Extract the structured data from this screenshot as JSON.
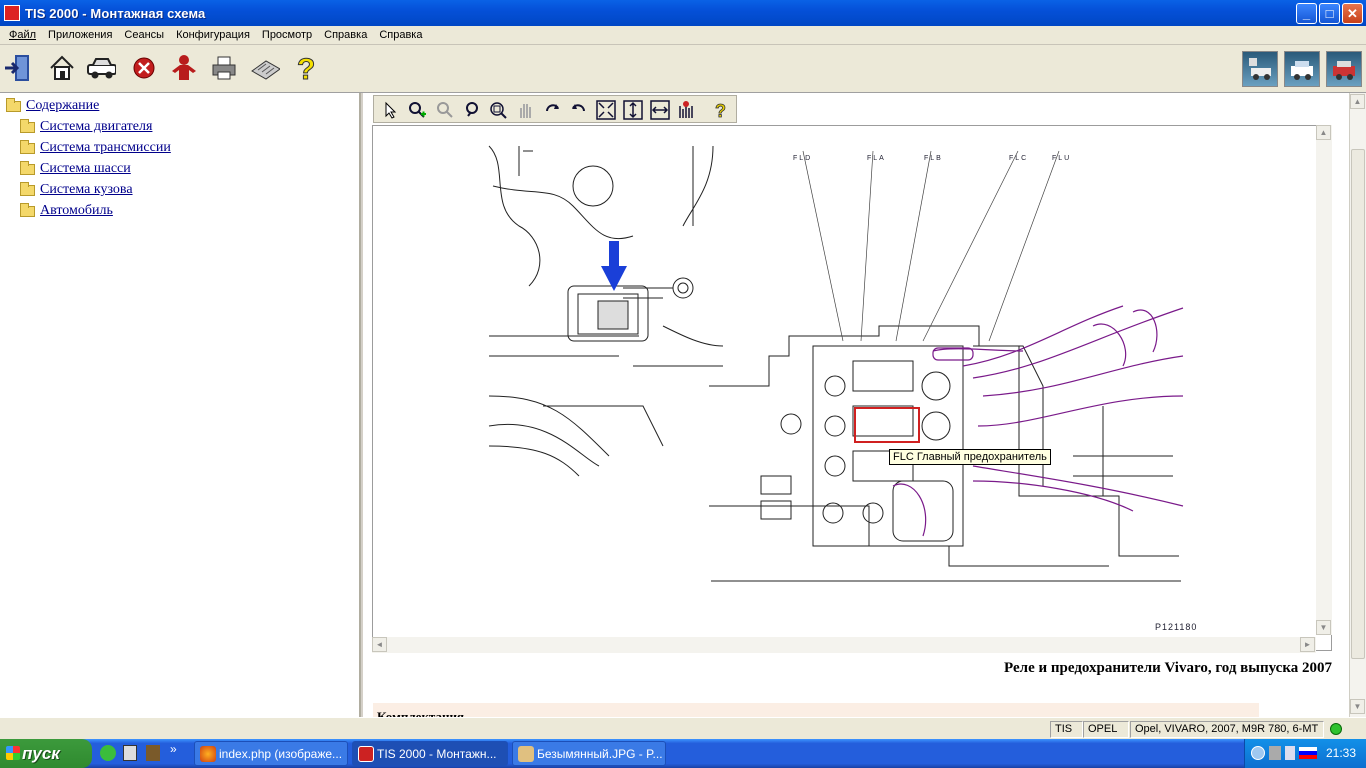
{
  "window": {
    "title": "TIS 2000 - Монтажная схема"
  },
  "menu": {
    "items": [
      "Файл",
      "Приложения",
      "Сеансы",
      "Конфигурация",
      "Просмотр",
      "Справка",
      "Справка"
    ]
  },
  "tree": {
    "root": "Содержание",
    "children": [
      "Система двигателя",
      "Система трансмиссии",
      "Система шасси",
      "Система кузова",
      "Автомобиль"
    ]
  },
  "diagram": {
    "fuse_labels": [
      "FLD",
      "FLA",
      "FLB",
      "FLC",
      "FLU"
    ],
    "tooltip": "FLC Главный предохранитель",
    "picture_number": "P121180",
    "caption": "Реле и предохранители Vivaro, год выпуска 2007"
  },
  "bottom_panel": {
    "text": "Комплектация"
  },
  "statusbar": {
    "fields": [
      "TIS",
      "OPEL",
      "Opel, VIVARO, 2007, M9R 780, 6-MT"
    ]
  },
  "taskbar": {
    "start": "пуск",
    "tasks": [
      "index.php (изображе...",
      "TIS 2000 - Монтажн...",
      "Безымянный.JPG - P..."
    ],
    "clock": "21:33"
  }
}
